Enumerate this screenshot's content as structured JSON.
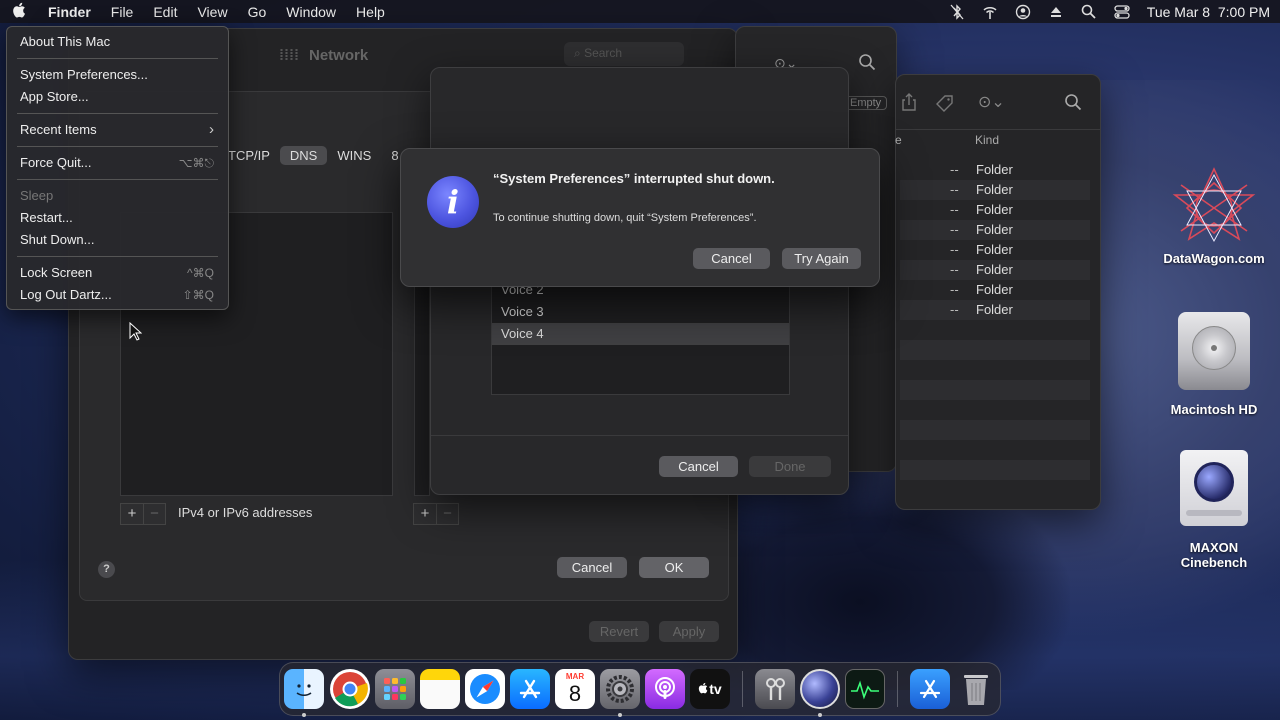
{
  "menubar": {
    "apple_glyph": "",
    "items": [
      "Finder",
      "File",
      "Edit",
      "View",
      "Go",
      "Window",
      "Help"
    ],
    "datetime": "Tue Mar 8  7:00 PM"
  },
  "apple_menu": {
    "about": "About This Mac",
    "sys_prefs": "System Preferences...",
    "app_store": "App Store...",
    "recent": "Recent Items",
    "recent_arrow": "›",
    "force_quit": "Force Quit...",
    "force_quit_sc": "⌥⌘⎋",
    "sleep": "Sleep",
    "restart": "Restart...",
    "shutdown": "Shut Down...",
    "lock": "Lock Screen",
    "lock_sc": "^⌘Q",
    "logout": "Log Out Dartz...",
    "logout_sc": "⇧⌘Q"
  },
  "network": {
    "title": "Network",
    "search_placeholder": "Search",
    "tabs": [
      "TCP/IP",
      "DNS",
      "WINS",
      "8"
    ],
    "ip_hint": "IPv4 or IPv6 addresses",
    "cancel": "Cancel",
    "ok": "OK",
    "revert": "Revert",
    "apply": "Apply",
    "help": "?"
  },
  "voice_sheet": {
    "voices": [
      "Voice 2",
      "Voice 3",
      "Voice 4"
    ],
    "selected": "Voice 4",
    "cancel": "Cancel",
    "done": "Done"
  },
  "alert": {
    "title": "“System Preferences” interrupted shut down.",
    "message": "To continue shutting down, quit “System Preferences”.",
    "cancel": "Cancel",
    "try_again": "Try Again",
    "icon_glyph": "i"
  },
  "finder": {
    "empty_label": "Empty",
    "kind_header": "Kind",
    "dash": "--",
    "kind": "Folder",
    "row_count": 8
  },
  "desktop": {
    "datawagon": "DataWagon.com",
    "macintosh": "Macintosh HD",
    "maxon_1": "MAXON",
    "maxon_2": "Cinebench"
  },
  "dock": {
    "calendar_month": "MAR",
    "calendar_day": "8",
    "tv_label": "tv"
  }
}
